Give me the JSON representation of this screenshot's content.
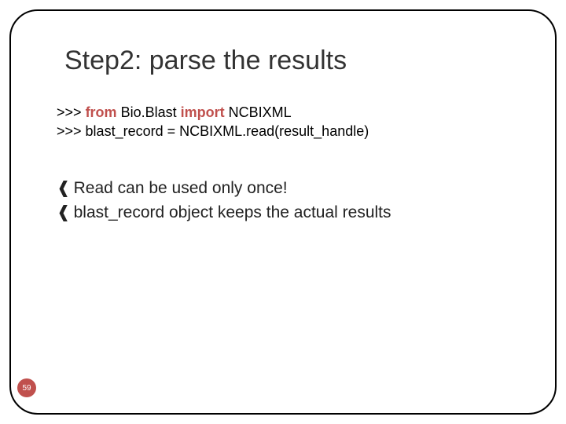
{
  "title": "Step2: parse the results",
  "code": {
    "line1": {
      "prompt": ">>>",
      "kw1": "from",
      "mod": " Bio.Blast ",
      "kw2": "import",
      "cls": " NCBIXML"
    },
    "line2": {
      "prompt": ">>>",
      "rest": " blast_record = NCBIXML.read(result_handle)"
    }
  },
  "bullets": {
    "glyph": "❰",
    "items": [
      "Read can be used only once!",
      "blast_record object keeps the actual results"
    ]
  },
  "page": "59"
}
